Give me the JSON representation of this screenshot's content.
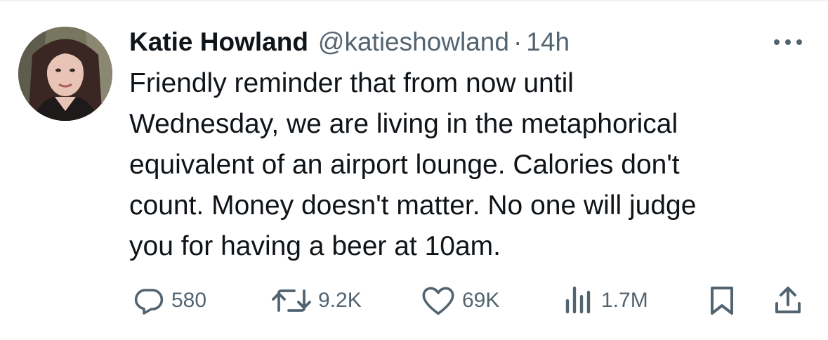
{
  "tweet": {
    "author_name": "Katie Howland",
    "author_handle": "@katieshowland",
    "separator": "·",
    "timestamp": "14h",
    "text": "Friendly reminder that from now until\nWednesday, we are living in the metaphorical\nequivalent of an airport lounge. Calories don't\ncount. Money doesn't matter. No one will judge\nyou for having a beer at 10am."
  },
  "stats": {
    "replies": "580",
    "reposts": "9.2K",
    "likes": "69K",
    "views": "1.7M"
  },
  "icons": {
    "more": "more-horizontal-icon",
    "reply": "reply-bubble-icon",
    "repost": "repost-arrows-icon",
    "like": "heart-icon",
    "views": "bar-chart-icon",
    "bookmark": "bookmark-icon",
    "share": "share-upload-icon"
  },
  "colors": {
    "text_primary": "#0f1419",
    "text_secondary": "#536471",
    "background": "#ffffff"
  }
}
